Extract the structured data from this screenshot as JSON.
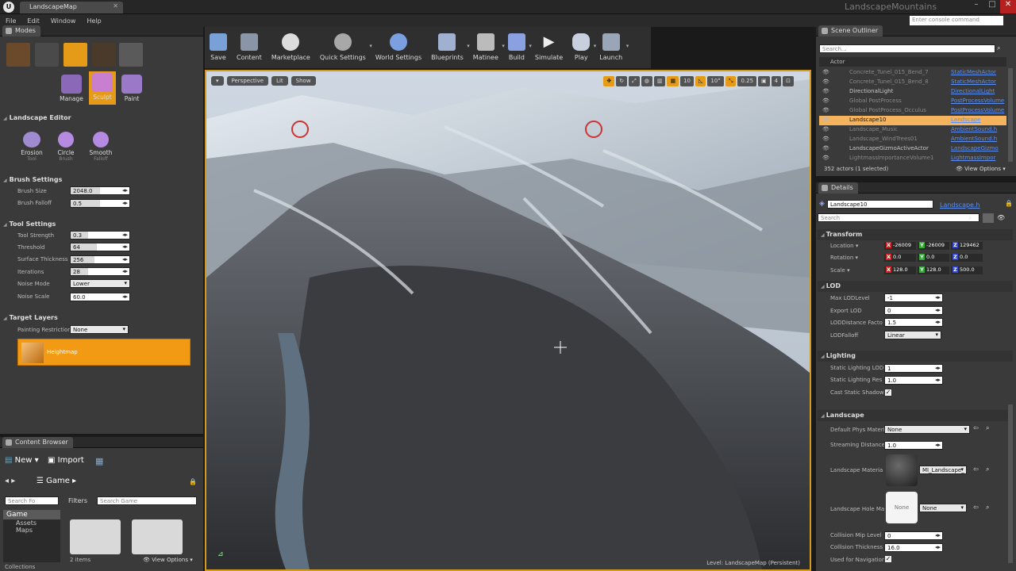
{
  "app": {
    "tab_title": "LandscapeMap",
    "project": "LandscapeMountains",
    "console_placeholder": "Enter console command"
  },
  "menu": [
    "File",
    "Edit",
    "Window",
    "Help"
  ],
  "modes": {
    "tab": "Modes",
    "big": [
      {
        "label": "Manage"
      },
      {
        "label": "Sculpt"
      },
      {
        "label": "Paint"
      }
    ],
    "editor_title": "Landscape Editor",
    "tools": [
      {
        "label": "Erosion",
        "sub": "Tool"
      },
      {
        "label": "Circle",
        "sub": "Brush"
      },
      {
        "label": "Smooth",
        "sub": "Falloff"
      }
    ],
    "brush_title": "Brush Settings",
    "brush": [
      {
        "label": "Brush Size",
        "value": "2048.0",
        "fill": 0.5
      },
      {
        "label": "Brush Falloff",
        "value": "0.5",
        "fill": 0.5
      }
    ],
    "tool_title": "Tool Settings",
    "tool": [
      {
        "label": "Tool Strength",
        "value": "0.3",
        "fill": 0.3
      },
      {
        "label": "Threshold",
        "value": "64",
        "fill": 0.45
      },
      {
        "label": "Surface Thickness",
        "value": "256",
        "fill": 0.4
      },
      {
        "label": "Iterations",
        "value": "28",
        "fill": 0.3
      }
    ],
    "noise_mode_label": "Noise Mode",
    "noise_mode": "Lower",
    "noise_scale_label": "Noise Scale",
    "noise_scale": "60.0",
    "target_title": "Target Layers",
    "paint_restr_label": "Painting Restriction",
    "paint_restr": "None",
    "layer": "Heightmap"
  },
  "content_browser": {
    "tab": "Content Browser",
    "new": "New",
    "import": "Import",
    "path": "Game",
    "search_folders": "Search Fo",
    "filters": "Filters",
    "search_game": "Search Game",
    "tree": [
      "Game",
      "Assets",
      "Maps"
    ],
    "items": "2 items",
    "view_options": "View Options",
    "collections": "Collections"
  },
  "toolbar": [
    "Save",
    "Content",
    "Marketplace",
    "Quick Settings",
    "World Settings",
    "Blueprints",
    "Matinee",
    "Build",
    "Simulate",
    "Play",
    "Launch"
  ],
  "viewport": {
    "perspective": "Perspective",
    "lit": "Lit",
    "show": "Show",
    "grid": "10",
    "angle": "10°",
    "scale": "0.25",
    "cam": "4",
    "level_label": "Level:",
    "level": "LandscapeMap (Persistent)"
  },
  "outliner": {
    "tab": "Scene Outliner",
    "search": "Search...",
    "col_label": "Actor",
    "rows": [
      {
        "name": "Concrete_Tunel_015_Bend_7",
        "type": "StaticMeshActor",
        "dim": true
      },
      {
        "name": "Concrete_Tunel_015_Bend_8",
        "type": "StaticMeshActor",
        "dim": true
      },
      {
        "name": "DirectionalLight",
        "type": "DirectionalLight",
        "dim": false
      },
      {
        "name": "Global PostProcess",
        "type": "PostProcessVolume",
        "dim": true
      },
      {
        "name": "Global PostProcess_Occulus",
        "type": "PostProcessVolume",
        "dim": true
      },
      {
        "name": "Landscape10",
        "type": "Landscape",
        "dim": false,
        "sel": true
      },
      {
        "name": "Landscape_Music",
        "type": "AmbientSound.h",
        "dim": true
      },
      {
        "name": "Landscape_WindTrees01",
        "type": "AmbientSound.h",
        "dim": true
      },
      {
        "name": "LandscapeGizmoActiveActor",
        "type": "LandscapeGizmo",
        "dim": false
      },
      {
        "name": "LightmassImportanceVolume1",
        "type": "LightmassImpor",
        "dim": true
      }
    ],
    "count": "352 actors (1 selected)",
    "view_options": "View Options"
  },
  "details": {
    "tab": "Details",
    "name": "Landscape10",
    "class": "Landscape.h",
    "search": "Search",
    "transform": "Transform",
    "location_label": "Location",
    "location": [
      "-26009",
      "-26009",
      "129462"
    ],
    "rotation_label": "Rotation",
    "rotation": [
      "0.0",
      "0.0",
      "0.0"
    ],
    "scale_label": "Scale",
    "scale": [
      "128.0",
      "128.0",
      "500.0"
    ],
    "lod": "LOD",
    "max_lod_label": "Max LODLevel",
    "max_lod": "-1",
    "export_lod_label": "Export LOD",
    "export_lod": "0",
    "lod_dist_label": "LODDistance Facto",
    "lod_dist": "1.5",
    "lod_falloff_label": "LODFalloff",
    "lod_falloff": "Linear",
    "lighting": "Lighting",
    "static_lod_label": "Static Lighting LOD",
    "static_lod": "1",
    "static_res_label": "Static Lighting Res",
    "static_res": "1.0",
    "cast_shadow_label": "Cast Static Shadow",
    "landscape": "Landscape",
    "phys_label": "Default Phys Materi",
    "phys": "None",
    "stream_label": "Streaming Distance",
    "stream": "1.0",
    "mat_label": "Landscape Materia",
    "mat": "MI_Landscape_",
    "hole_label": "Landscape Hole Ma",
    "hole": "None",
    "hole_thumb": "None",
    "coll_mip_label": "Collision Mip Level",
    "coll_mip": "0",
    "coll_thick_label": "Collision Thickness",
    "coll_thick": "16.0",
    "nav_label": "Used for Navigation"
  }
}
